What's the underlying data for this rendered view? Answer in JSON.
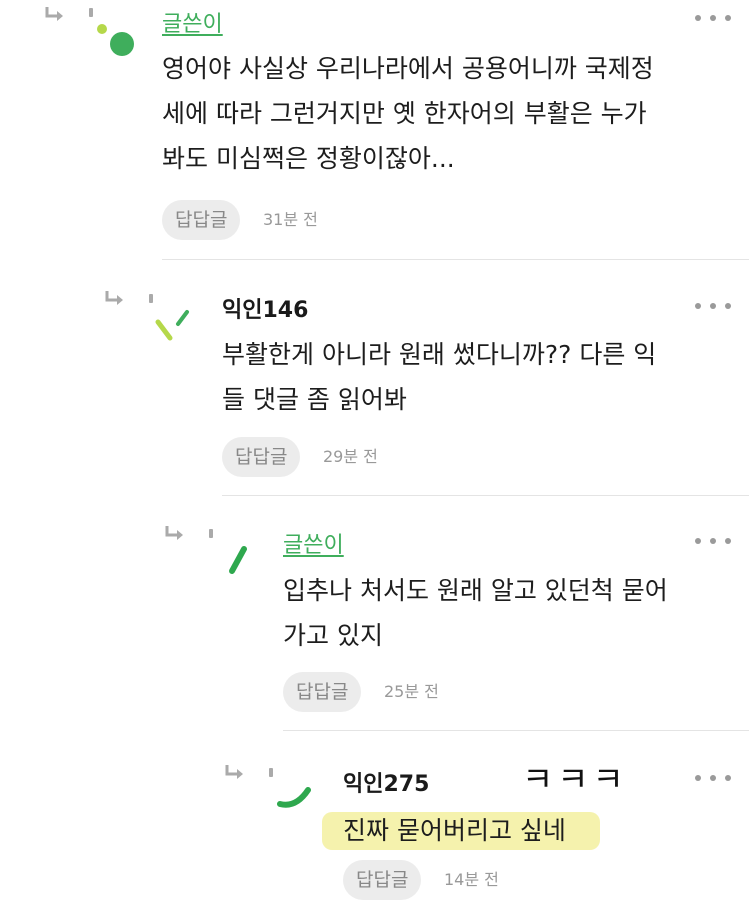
{
  "comments": [
    {
      "author": "글쓴이",
      "is_op": true,
      "text_lines": [
        "영어야 사실상 우리나라에서 공용어니까 국제정",
        "세에 따라 그런거지만 옛 한자어의 부활은 누가",
        "봐도 미심쩍은 정황이잖아..."
      ],
      "reply_label": "답답글",
      "time": "31분 전"
    },
    {
      "author": "익인146",
      "is_op": false,
      "text_lines": [
        "부활한게 아니라 원래 썼다니까?? 다른 익",
        "들 댓글 좀 읽어봐"
      ],
      "reply_label": "답답글",
      "time": "29분 전"
    },
    {
      "author": "글쓴이",
      "is_op": true,
      "text_lines": [
        "입추나 처서도 원래 알고 있던척 묻어",
        "가고 있지"
      ],
      "reply_label": "답답글",
      "time": "25분 전"
    },
    {
      "author": "익인275",
      "is_op": false,
      "text_lines": [
        "진짜 묻어버리고 싶네"
      ],
      "reply_label": "답답글",
      "time": "14분 전"
    }
  ],
  "annotation": {
    "handwritten": "ㅋㅋㅋ",
    "highlight_color": "#f4f1a4"
  },
  "colors": {
    "op_name": "#3fae5c",
    "avatar_green": "#3fae5c",
    "avatar_lime": "#b5d84a",
    "arrow_gray": "#aaaaaa"
  },
  "icons": {
    "reply_arrow": "reply-arrow-icon",
    "more": "more-dots-icon"
  }
}
